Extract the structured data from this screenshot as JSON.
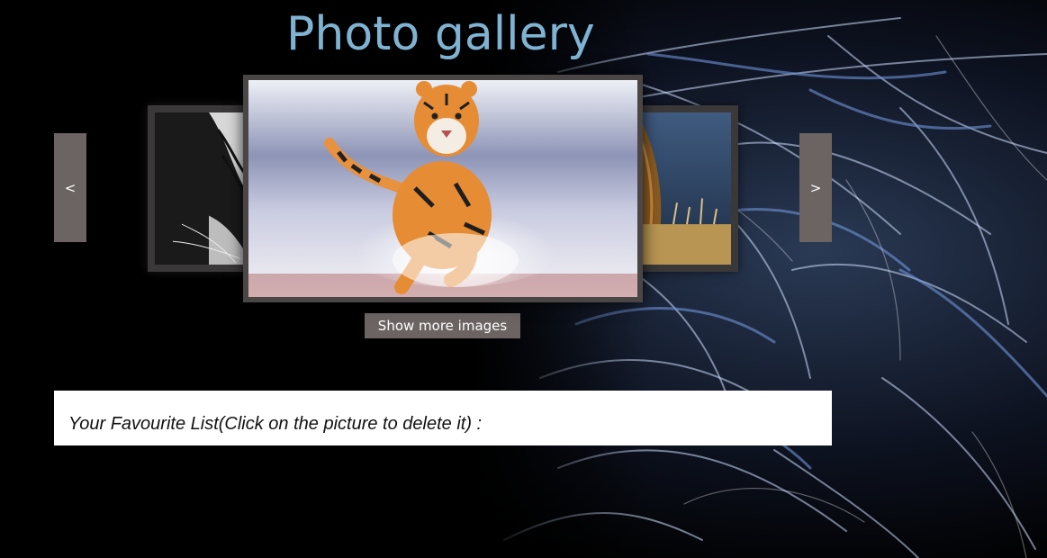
{
  "page": {
    "title": "Photo gallery"
  },
  "carousel": {
    "prev_label": "<",
    "next_label": ">",
    "images": [
      {
        "name": "white-tiger-closeup",
        "position": "left"
      },
      {
        "name": "tiger-running-in-snow",
        "position": "center"
      },
      {
        "name": "lion-in-grass",
        "position": "right"
      }
    ]
  },
  "actions": {
    "show_more_label": "Show more images"
  },
  "favourites": {
    "label": "Your Favourite List(Click on the picture to delete it) :"
  },
  "colors": {
    "title": "#7fb3d2",
    "button_bg": "#6b6463",
    "panel_bg": "#ffffff",
    "page_bg": "#000000"
  }
}
